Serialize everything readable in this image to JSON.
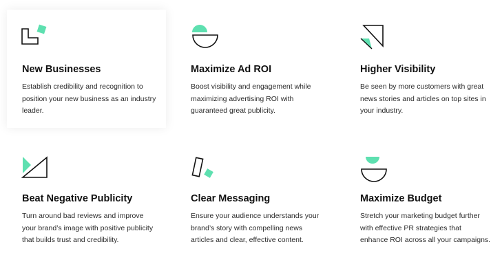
{
  "accent_color": "#5ee0b0",
  "features": [
    {
      "icon": "l-shape-square-icon",
      "title": "New Businesses",
      "description": "Establish credibility and recognition to position your new business as an industry leader."
    },
    {
      "icon": "semicircle-bowl-icon",
      "title": "Maximize Ad ROI",
      "description": "Boost visibility and engagement while maximizing advertising ROI with guaranteed great publicity."
    },
    {
      "icon": "triangle-split-icon",
      "title": "Higher Visibility",
      "description": "Be seen by more customers with great news stories and articles on top sites in your industry."
    },
    {
      "icon": "diagonal-triangle-icon",
      "title": "Beat Negative Publicity",
      "description": "Turn around bad reviews and improve your brand’s image with positive publicity that builds trust and credibility."
    },
    {
      "icon": "tilted-card-icon",
      "title": "Clear Messaging",
      "description": "Ensure your audience understands your brand’s story with compelling news articles and clear, effective content."
    },
    {
      "icon": "bowl-semicircle-icon",
      "title": "Maximize Budget",
      "description": "Stretch your marketing budget further with effective PR strategies that enhance ROI across all your campaigns."
    }
  ]
}
